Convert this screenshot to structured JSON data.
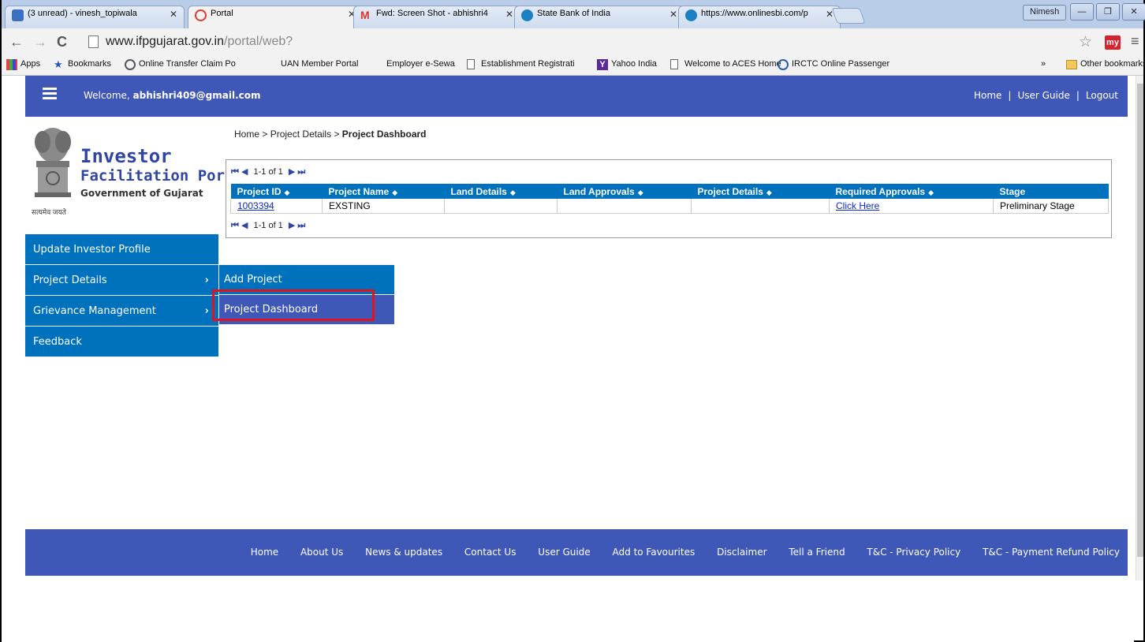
{
  "browser": {
    "tabs": [
      {
        "label": "(3 unread) - vinesh_topiwala",
        "icon": "mail-icon"
      },
      {
        "label": "Portal",
        "icon": "portal-icon"
      },
      {
        "label": "Fwd: Screen Shot - abhishri4",
        "icon": "gmail-icon"
      },
      {
        "label": "State Bank of India",
        "icon": "sbi-icon"
      },
      {
        "label": "https://www.onlinesbi.com/p",
        "icon": "sbi-icon"
      }
    ],
    "profile_name": "Nimesh",
    "url_host": "www.ifpgujarat.gov.in",
    "url_path": "/portal/web?",
    "bookmarks": [
      "Apps",
      "Bookmarks",
      "Online Transfer Claim Po",
      "UAN Member Portal",
      "Employer e-Sewa",
      "Establishment Registrati",
      "Yahoo India",
      "Welcome to ACES Home",
      "IRCTC Online Passenger"
    ],
    "bookmarks_overflow": "»",
    "other_bookmarks": "Other bookmarks"
  },
  "header": {
    "welcome_prefix": "Welcome,",
    "user_email": "abhishri409@gmail.com",
    "links": {
      "home": "Home",
      "user_guide": "User Guide",
      "logout": "Logout",
      "sep": "|"
    }
  },
  "logo": {
    "line1": "Investor",
    "line2": "Facilitation Portal",
    "line3": "Government of Gujarat",
    "motto": "सत्यमेव जयते"
  },
  "breadcrumb": {
    "home": "Home",
    "sep": ">",
    "section": "Project Details",
    "current": "Project Dashboard"
  },
  "pager": {
    "first": "⏮",
    "prev": "◀",
    "count": "1-1 of 1",
    "next": "▶",
    "last": "⏭"
  },
  "grid": {
    "columns": [
      "Project ID",
      "Project Name",
      "Land Details",
      "Land Approvals",
      "Project Details",
      "Required Approvals",
      "Stage"
    ],
    "rows": [
      {
        "project_id": "1003394",
        "project_name": "EXSTING",
        "land_details": "",
        "land_approvals": "",
        "project_details": "",
        "required_approvals": "Click Here",
        "stage": "Preliminary Stage"
      }
    ]
  },
  "sidemenu": {
    "items": [
      {
        "label": "Update Investor Profile"
      },
      {
        "label": "Project Details",
        "chevron": "›"
      },
      {
        "label": "Grievance Management",
        "chevron": "›"
      },
      {
        "label": "Feedback"
      }
    ]
  },
  "submenu": {
    "items": [
      {
        "label": "Add Project"
      },
      {
        "label": "Project Dashboard"
      }
    ]
  },
  "footer": {
    "links": [
      "Home",
      "About Us",
      "News & updates",
      "Contact Us",
      "User Guide",
      "Add to Favourites",
      "Disclaimer",
      "Tell a Friend",
      "T&C - Privacy Policy",
      "T&C - Payment Refund Policy"
    ]
  },
  "colors": {
    "header_blue": "#3f57b7",
    "menu_blue": "#0071bc",
    "highlight_red": "#e0141e"
  }
}
